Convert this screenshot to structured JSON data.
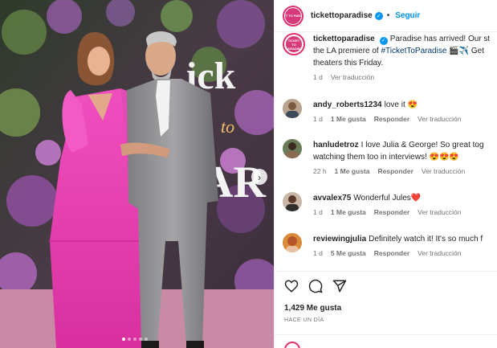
{
  "post": {
    "carousel": {
      "next_label": "›",
      "dot_count": 5,
      "active_dot": 0
    }
  },
  "header": {
    "avatar_text": "TICKET TO PARADISE",
    "username": "tickettoparadise",
    "verified": "✓",
    "separator": "•",
    "follow_label": "Seguir"
  },
  "caption": {
    "username": "tickettoparadise",
    "line1": "Paradise has arrived! Our st",
    "line2_prefix": "the LA premiere of ",
    "hashtag": "#TicketToParadise",
    "line2_suffix": " 🎬✈️ Get",
    "line3": "theaters this Friday.",
    "time": "1 d",
    "translate": "Ver traducción"
  },
  "comments": [
    {
      "username": "andy_roberts1234",
      "text": "love it 😍",
      "line2": "",
      "time": "1 d",
      "likes": "1 Me gusta",
      "reply": "Responder",
      "translate": "Ver traducción"
    },
    {
      "username": "hanludetroz",
      "text": "I love Julia & George! So great tog",
      "line2": "watching them too in interviews! 😍😍😍",
      "time": "22 h",
      "likes": "1 Me gusta",
      "reply": "Responder",
      "translate": "Ver traducción"
    },
    {
      "username": "avvalex75",
      "text": "Wonderful Jules❤️",
      "line2": "",
      "time": "1 d",
      "likes": "1 Me gusta",
      "reply": "Responder",
      "translate": "Ver traducción"
    },
    {
      "username": "reviewingjulia",
      "text": "Definitely watch it! It's so much f",
      "line2": "",
      "time": "1 d",
      "likes": "5 Me gusta",
      "reply": "Responder",
      "translate": "Ver traducción"
    }
  ],
  "actions": {
    "like_icon": "heart-icon",
    "comment_icon": "comment-icon",
    "share_icon": "share-icon",
    "likes_count": "1,429 Me gusta",
    "posted": "HACE UN DÍA"
  },
  "colors": {
    "accent": "#0095f6",
    "verified": "#0095f6",
    "brand_ring": "#e1306c",
    "heart_red": "#e0245e",
    "dress_pink": "#e93fb4"
  }
}
